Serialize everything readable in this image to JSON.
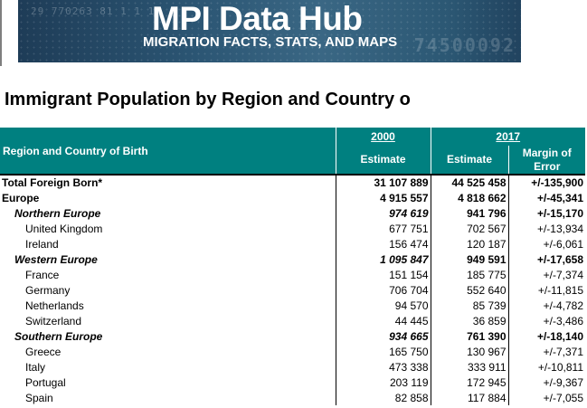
{
  "banner": {
    "title": "MPI Data Hub",
    "subtitle": "MIGRATION FACTS, STATS, AND MAPS"
  },
  "page_title": "Immigrant Population by Region and Country o",
  "table": {
    "header_label": "Region and Country of Birth",
    "year_2000": "2000",
    "year_2017": "2017",
    "estimate_2000": "Estimate",
    "estimate_2017": "Estimate",
    "margin_of_error": "Margin of Error",
    "rows": [
      {
        "name": "Total Foreign Born*",
        "v2000": "31 107 889",
        "v2017": "44 525 458",
        "moe": "+/-135,900"
      },
      {
        "name": "Europe",
        "v2000": "4 915 557",
        "v2017": "4 818 662",
        "moe": "+/-45,341"
      },
      {
        "name": "Northern Europe",
        "v2000": "974 619",
        "v2017": "941 796",
        "moe": "+/-15,170"
      },
      {
        "name": "United Kingdom",
        "v2000": "677 751",
        "v2017": "702 567",
        "moe": "+/-13,934"
      },
      {
        "name": "Ireland",
        "v2000": "156 474",
        "v2017": "120 187",
        "moe": "+/-6,061"
      },
      {
        "name": "Western Europe",
        "v2000": "1 095 847",
        "v2017": "949 591",
        "moe": "+/-17,658"
      },
      {
        "name": "France",
        "v2000": "151 154",
        "v2017": "185 775",
        "moe": "+/-7,374"
      },
      {
        "name": "Germany",
        "v2000": "706 704",
        "v2017": "552 640",
        "moe": "+/-11,815"
      },
      {
        "name": "Netherlands",
        "v2000": "94 570",
        "v2017": "85 739",
        "moe": "+/-4,782"
      },
      {
        "name": "Switzerland",
        "v2000": "44 445",
        "v2017": "36 859",
        "moe": "+/-3,486"
      },
      {
        "name": "Southern Europe",
        "v2000": "934 665",
        "v2017": "761 390",
        "moe": "+/-18,140"
      },
      {
        "name": "Greece",
        "v2000": "165 750",
        "v2017": "130 967",
        "moe": "+/-7,371"
      },
      {
        "name": "Italy",
        "v2000": "473 338",
        "v2017": "333 911",
        "moe": "+/-10,811"
      },
      {
        "name": "Portugal",
        "v2000": "203 119",
        "v2017": "172 945",
        "moe": "+/-9,367"
      },
      {
        "name": "Spain",
        "v2000": "82 858",
        "v2017": "117 884",
        "moe": "+/-7,055"
      }
    ]
  }
}
